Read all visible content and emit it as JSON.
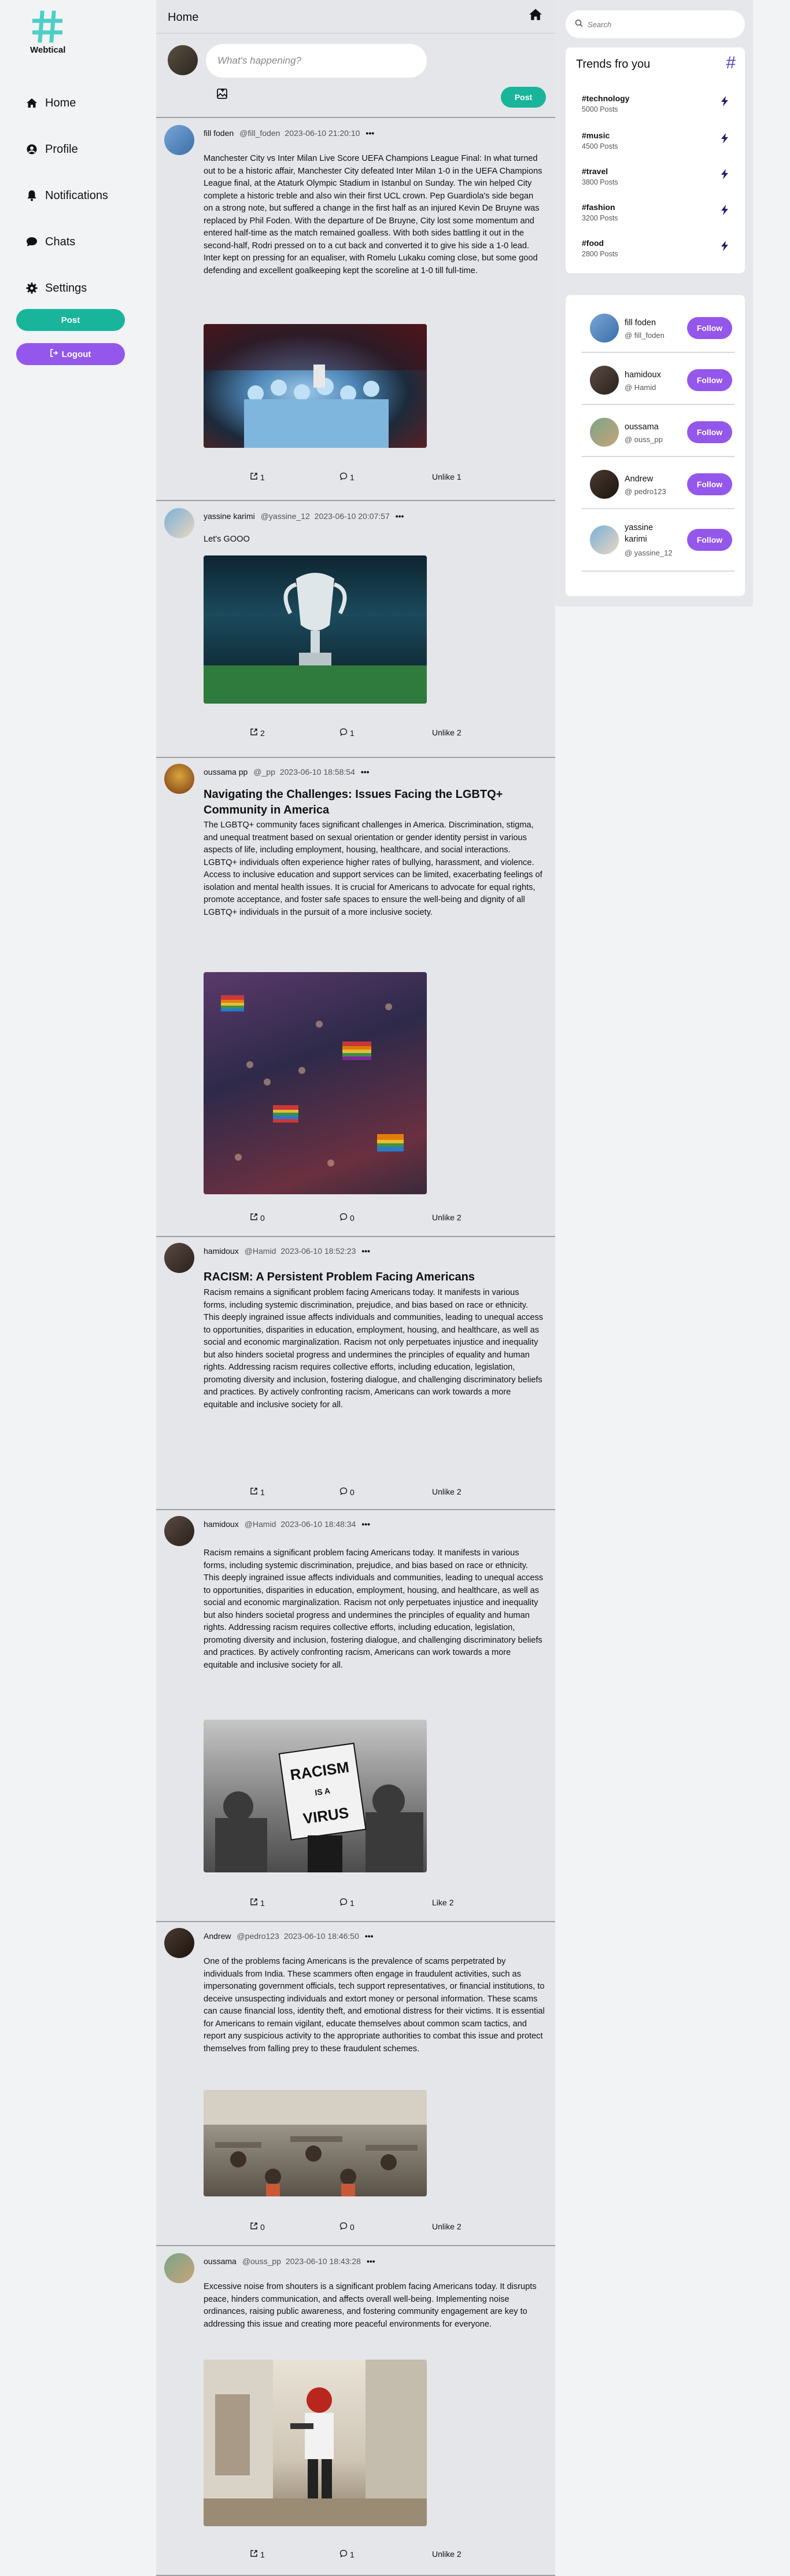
{
  "app": {
    "name": "Webtical"
  },
  "sidebar": {
    "items": [
      {
        "label": "Home",
        "icon": "home-icon"
      },
      {
        "label": "Profile",
        "icon": "user-icon"
      },
      {
        "label": "Notifications",
        "icon": "bell-icon"
      },
      {
        "label": "Chats",
        "icon": "chat-icon"
      },
      {
        "label": "Settings",
        "icon": "gear-icon"
      }
    ],
    "post_label": "Post",
    "logout_label": "Logout"
  },
  "feed": {
    "title": "Home",
    "composer": {
      "placeholder": "What's happening?",
      "post_label": "Post"
    },
    "posts": [
      {
        "name": "fill foden",
        "handle": "@fill_foden",
        "date": "2023-06-10 21:20:10",
        "dots": "•••",
        "title": "",
        "text": "Manchester City vs Inter Milan Live Score UEFA Champions League Final: In what turned out to be a historic affair, Manchester City defeated Inter Milan 1-0 in the UEFA Champions League final, at the Ataturk Olympic Stadium in Istanbul on Sunday. The win helped City complete a historic treble and also win their first UCL crown. Pep Guardiola's side began on a strong note, but suffered a change in the first half as an injured Kevin De Bruyne was replaced by Phil Foden. With the departure of De Bruyne, City lost some momentum and entered half-time as the match remained goalless. With both sides battling it out in the second-half, Rodri pressed on to a cut back and converted it to give his side a 1-0 lead. Inter kept on pressing for an equaliser, with Romelu Lukaku coming close, but some good defending and excellent goalkeeping kept the scoreline at 1-0 till full-time.",
        "shares": "1",
        "comments": "1",
        "like_label": "Unlike",
        "likes": "1"
      },
      {
        "name": "yassine karimi",
        "handle": "@yassine_12",
        "date": "2023-06-10 20:07:57",
        "dots": "•••",
        "title": "",
        "text": "Let's GOOO",
        "shares": "2",
        "comments": "1",
        "like_label": "Unlike",
        "likes": "2"
      },
      {
        "name": "oussama pp",
        "handle": "@_pp",
        "date": "2023-06-10 18:58:54",
        "dots": "•••",
        "title": "Navigating the Challenges: Issues Facing the LGBTQ+ Community in America",
        "text": "The LGBTQ+ community faces significant challenges in America. Discrimination, stigma, and unequal treatment based on sexual orientation or gender identity persist in various aspects of life, including employment, housing, healthcare, and social interactions. LGBTQ+ individuals often experience higher rates of bullying, harassment, and violence. Access to inclusive education and support services can be limited, exacerbating feelings of isolation and mental health issues. It is crucial for Americans to advocate for equal rights, promote acceptance, and foster safe spaces to ensure the well-being and dignity of all LGBTQ+ individuals in the pursuit of a more inclusive society.",
        "shares": "0",
        "comments": "0",
        "like_label": "Unlike",
        "likes": "2"
      },
      {
        "name": "hamidoux",
        "handle": "@Hamid",
        "date": "2023-06-10 18:52:23",
        "dots": "•••",
        "title": "RACISM: A Persistent Problem Facing Americans",
        "text": "Racism remains a significant problem facing Americans today. It manifests in various forms, including systemic discrimination, prejudice, and bias based on race or ethnicity. This deeply ingrained issue affects individuals and communities, leading to unequal access to opportunities, disparities in education, employment, housing, and healthcare, as well as social and economic marginalization. Racism not only perpetuates injustice and inequality but also hinders societal progress and undermines the principles of equality and human rights. Addressing racism requires collective efforts, including education, legislation, promoting diversity and inclusion, fostering dialogue, and challenging discriminatory beliefs and practices. By actively confronting racism, Americans can work towards a more equitable and inclusive society for all.",
        "shares": "1",
        "comments": "0",
        "like_label": "Unlike",
        "likes": "2"
      },
      {
        "name": "hamidoux",
        "handle": "@Hamid",
        "date": "2023-06-10 18:48:34",
        "dots": "•••",
        "title": "",
        "text": "Racism remains a significant problem facing Americans today. It manifests in various forms, including systemic discrimination, prejudice, and bias based on race or ethnicity. This deeply ingrained issue affects individuals and communities, leading to unequal access to opportunities, disparities in education, employment, housing, and healthcare, as well as social and economic marginalization. Racism not only perpetuates injustice and inequality but also hinders societal progress and undermines the principles of equality and human rights. Addressing racism requires collective efforts, including education, legislation, promoting diversity and inclusion, fostering dialogue, and challenging discriminatory beliefs and practices. By actively confronting racism, Americans can work towards a more equitable and inclusive society for all.",
        "image_text": "RACISM IS A VIRUS",
        "shares": "1",
        "comments": "1",
        "like_label": "Like",
        "likes": "2"
      },
      {
        "name": "Andrew",
        "handle": "@pedro123",
        "date": "2023-06-10 18:46:50",
        "dots": "•••",
        "title": "",
        "text": "One of the problems facing Americans is the prevalence of scams perpetrated by individuals from India. These scammers often engage in fraudulent activities, such as impersonating government officials, tech support representatives, or financial institutions, to deceive unsuspecting individuals and extort money or personal information. These scams can cause financial loss, identity theft, and emotional distress for their victims. It is essential for Americans to remain vigilant, educate themselves about common scam tactics, and report any suspicious activity to the appropriate authorities to combat this issue and protect themselves from falling prey to these fraudulent schemes.",
        "shares": "0",
        "comments": "0",
        "like_label": "Unlike",
        "likes": "2"
      },
      {
        "name": "oussama",
        "handle": "@ouss_pp",
        "date": "2023-06-10 18:43:28",
        "dots": "•••",
        "title": "",
        "text": "Excessive noise from shouters is a significant problem facing Americans today. It disrupts peace, hinders communication, and affects overall well-being. Implementing noise ordinances, raising public awareness, and fostering community engagement are key to addressing this issue and creating more peaceful environments for everyone.",
        "shares": "1",
        "comments": "1",
        "like_label": "Unlike",
        "likes": "2"
      }
    ]
  },
  "right": {
    "search_placeholder": "Search",
    "trends_title": "Trends fro you",
    "trends": [
      {
        "tag": "#technology",
        "count": "5000 Posts"
      },
      {
        "tag": "#music",
        "count": "4500 Posts"
      },
      {
        "tag": "#travel",
        "count": "3800 Posts"
      },
      {
        "tag": "#fashion",
        "count": "3200 Posts"
      },
      {
        "tag": "#food",
        "count": "2800 Posts"
      }
    ],
    "suggestions": [
      {
        "name": "fill foden",
        "handle": "@ fill_foden"
      },
      {
        "name": "hamidoux",
        "handle": "@ Hamid"
      },
      {
        "name": "oussama",
        "handle": "@ ouss_pp"
      },
      {
        "name": "Andrew",
        "handle": "@ pedro123"
      },
      {
        "name": "yassine karimi",
        "handle": "@ yassine_12"
      }
    ],
    "follow_label": "Follow"
  },
  "colors": {
    "teal": "#19b59a",
    "purple": "#9457eb",
    "logo": "#4ccfc6"
  }
}
